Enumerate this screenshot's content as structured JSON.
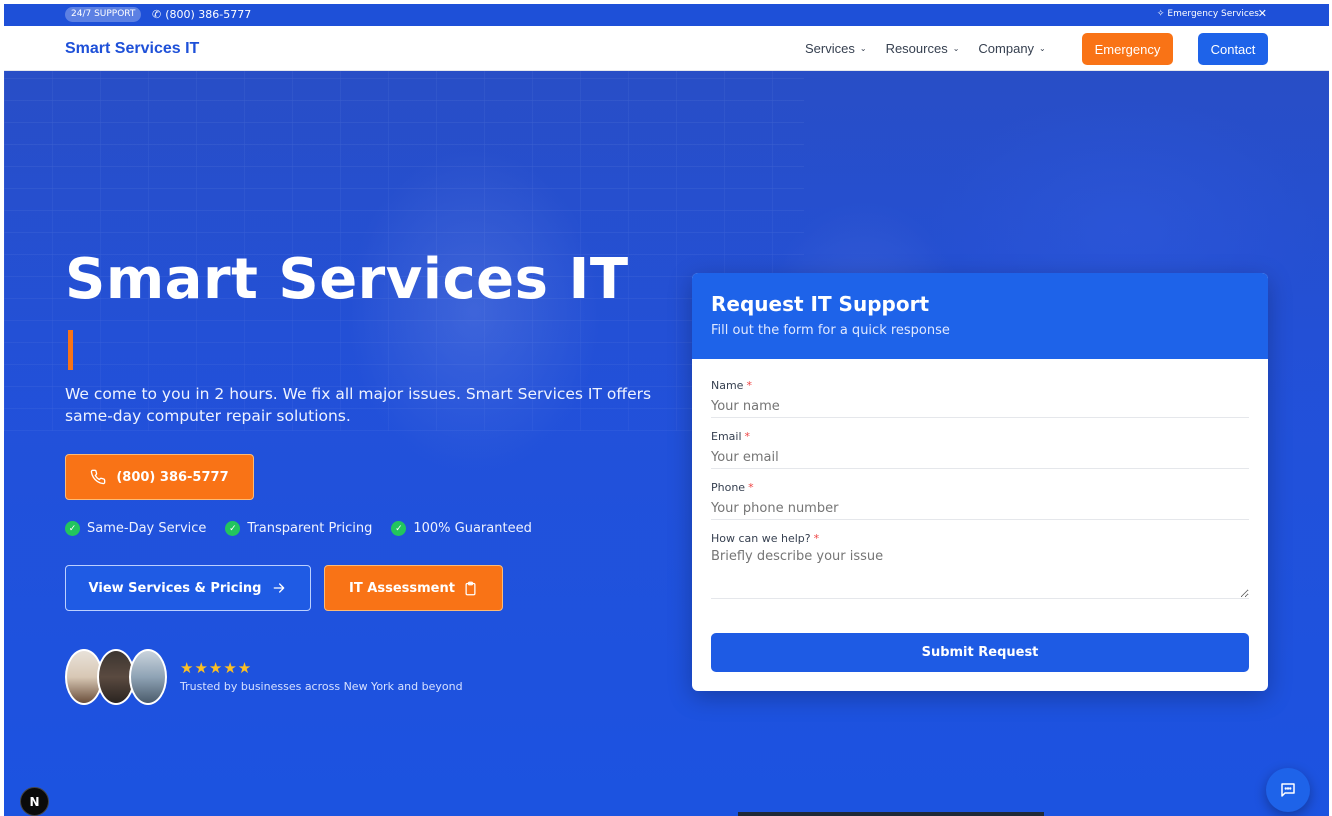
{
  "topbar": {
    "badge": "24/7 SUPPORT",
    "phone": "(800) 386-5777",
    "emergency_label": "Emergency Services",
    "close_glyph": "✕"
  },
  "nav": {
    "brand": "Smart Services IT",
    "menu": [
      {
        "label": "Services"
      },
      {
        "label": "Resources"
      },
      {
        "label": "Company"
      }
    ],
    "emergency_button": "Emergency",
    "contact_button": "Contact"
  },
  "hero": {
    "title": "Smart Services IT",
    "lead": "We come to you in 2 hours. We fix all major issues. Smart Services IT offers same-day computer repair solutions.",
    "phone_button": "(800) 386-5777",
    "checks": [
      "Same-Day Service",
      "Transparent Pricing",
      "100% Guaranteed"
    ],
    "view_button": "View Services & Pricing",
    "assessment_button": "IT Assessment",
    "rating_stars": "★★★★★",
    "trusted_text": "Trusted by businesses across New York and beyond"
  },
  "form": {
    "title": "Request IT Support",
    "subtitle": "Fill out the form for a quick response",
    "fields": [
      {
        "label": "Name",
        "placeholder": "Your name"
      },
      {
        "label": "Email",
        "placeholder": "Your email"
      },
      {
        "label": "Phone",
        "placeholder": "Your phone number"
      },
      {
        "label": "How can we help?",
        "placeholder": "Briefly describe your issue"
      }
    ],
    "required_mark": "*",
    "submit_label": "Submit Request"
  },
  "colors": {
    "brand_blue": "#1e63e9",
    "accent_orange": "#f97316",
    "check_green": "#22c55e"
  },
  "icons": [
    "phone-icon",
    "sparkle-icon",
    "close-icon",
    "chevron-down-icon",
    "check-icon",
    "arrow-right-icon",
    "clipboard-icon",
    "star-icon",
    "chat-icon",
    "next-logo-icon"
  ]
}
